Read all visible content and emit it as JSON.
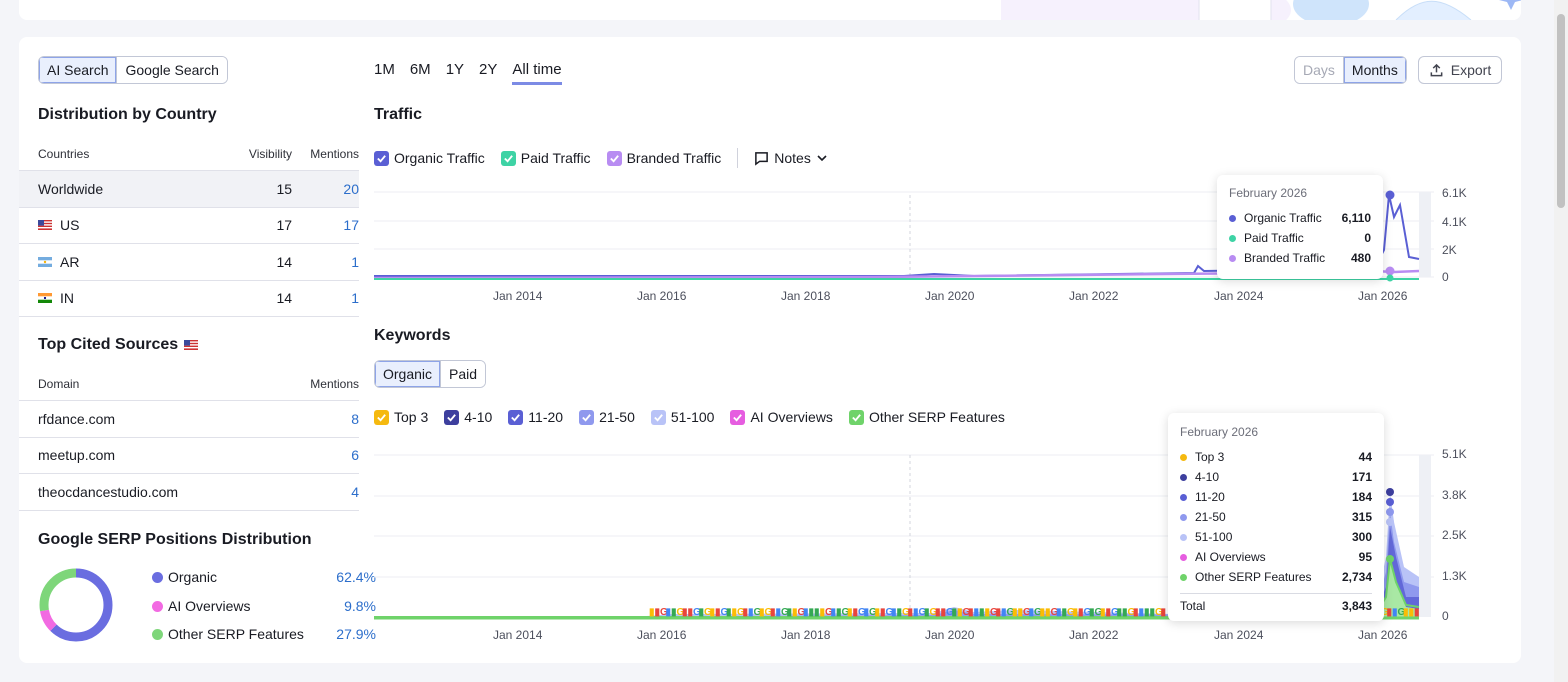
{
  "search_tabs": [
    "AI Search",
    "Google Search"
  ],
  "country_section": {
    "title": "Distribution by Country",
    "headers": {
      "country": "Countries",
      "visibility": "Visibility",
      "mentions": "Mentions"
    },
    "rows": [
      {
        "country": "Worldwide",
        "visibility": "15",
        "mentions": "20"
      },
      {
        "country": "US",
        "visibility": "17",
        "mentions": "17"
      },
      {
        "country": "AR",
        "visibility": "14",
        "mentions": "1"
      },
      {
        "country": "IN",
        "visibility": "14",
        "mentions": "1"
      }
    ]
  },
  "sources_section": {
    "title": "Top Cited Sources",
    "headers": {
      "domain": "Domain",
      "mentions": "Mentions"
    },
    "rows": [
      {
        "domain": "rfdance.com",
        "mentions": "8"
      },
      {
        "domain": "meetup.com",
        "mentions": "6"
      },
      {
        "domain": "theocdancestudio.com",
        "mentions": "4"
      }
    ]
  },
  "serp_section": {
    "title": "Google SERP Positions Distribution",
    "items": [
      {
        "name": "Organic",
        "pct": "62.4%",
        "value": 62.4,
        "color": "#6a6de0"
      },
      {
        "name": "AI Overviews",
        "pct": "9.8%",
        "value": 9.8,
        "color": "#f26ae2"
      },
      {
        "name": "Other SERP Features",
        "pct": "27.9%",
        "value": 27.9,
        "color": "#7ed67a"
      }
    ]
  },
  "time_ranges": [
    "1M",
    "6M",
    "1Y",
    "2Y",
    "All time"
  ],
  "period_toggle": [
    "Days",
    "Months"
  ],
  "export_label": "Export",
  "traffic": {
    "title": "Traffic",
    "legend": [
      {
        "name": "Organic Traffic",
        "color": "#5a5fd4"
      },
      {
        "name": "Paid Traffic",
        "color": "#3ed3a5"
      },
      {
        "name": "Branded Traffic",
        "color": "#b88cf2"
      }
    ],
    "notes_label": "Notes",
    "y_ticks": [
      "6.1K",
      "4.1K",
      "2K",
      "0"
    ],
    "x_ticks": [
      "Jan 2014",
      "Jan 2016",
      "Jan 2018",
      "Jan 2020",
      "Jan 2022",
      "Jan 2024",
      "Jan 2026"
    ],
    "tooltip": {
      "title": "February 2026",
      "rows": [
        {
          "name": "Organic Traffic",
          "value": "6,110",
          "color": "#5a5fd4"
        },
        {
          "name": "Paid Traffic",
          "value": "0",
          "color": "#3ed3a5"
        },
        {
          "name": "Branded Traffic",
          "value": "480",
          "color": "#b88cf2"
        }
      ]
    }
  },
  "keywords": {
    "title": "Keywords",
    "tabs": [
      "Organic",
      "Paid"
    ],
    "legend": [
      {
        "name": "Top 3",
        "color": "#f5b90f"
      },
      {
        "name": "4-10",
        "color": "#3d3f9e"
      },
      {
        "name": "11-20",
        "color": "#5a5fd4"
      },
      {
        "name": "21-50",
        "color": "#8f99ee"
      },
      {
        "name": "51-100",
        "color": "#b9c3f7"
      },
      {
        "name": "AI Overviews",
        "color": "#e65de0"
      },
      {
        "name": "Other SERP Features",
        "color": "#6fd36a"
      }
    ],
    "y_ticks": [
      "5.1K",
      "3.8K",
      "2.5K",
      "1.3K",
      "0"
    ],
    "x_ticks": [
      "Jan 2014",
      "Jan 2016",
      "Jan 2018",
      "Jan 2020",
      "Jan 2022",
      "Jan 2024",
      "Jan 2026"
    ],
    "tooltip": {
      "title": "February 2026",
      "rows": [
        {
          "name": "Top 3",
          "value": "44",
          "color": "#f5b90f"
        },
        {
          "name": "4-10",
          "value": "171",
          "color": "#3d3f9e"
        },
        {
          "name": "11-20",
          "value": "184",
          "color": "#5a5fd4"
        },
        {
          "name": "21-50",
          "value": "315",
          "color": "#8f99ee"
        },
        {
          "name": "51-100",
          "value": "300",
          "color": "#b9c3f7"
        },
        {
          "name": "AI Overviews",
          "value": "95",
          "color": "#e65de0"
        },
        {
          "name": "Other SERP Features",
          "value": "2,734",
          "color": "#6fd36a"
        }
      ],
      "total_label": "Total",
      "total_value": "3,843"
    }
  }
}
